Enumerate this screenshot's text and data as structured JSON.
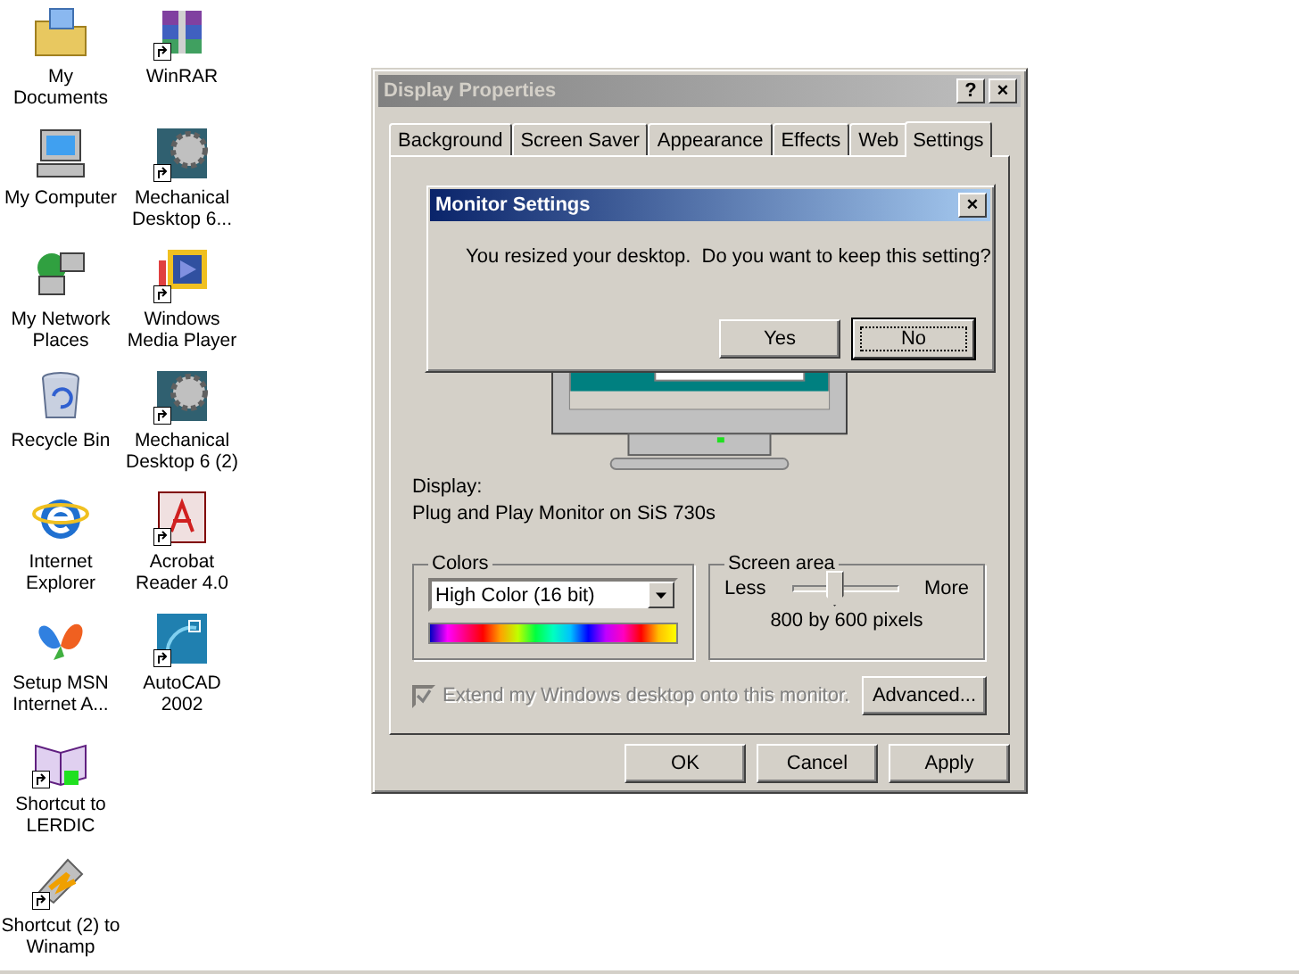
{
  "desktop_icons": [
    {
      "label": "My Documents",
      "shortcut": false
    },
    {
      "label": "My Computer",
      "shortcut": false
    },
    {
      "label": "My Network Places",
      "shortcut": false
    },
    {
      "label": "Recycle Bin",
      "shortcut": false
    },
    {
      "label": "Internet Explorer",
      "shortcut": false
    },
    {
      "label": "Setup MSN Internet A...",
      "shortcut": false
    },
    {
      "label": "Shortcut to LERDIC",
      "shortcut": true
    },
    {
      "label": "Shortcut (2) to Winamp",
      "shortcut": true
    },
    {
      "label": "WinRAR",
      "shortcut": true
    },
    {
      "label": "Mechanical Desktop 6...",
      "shortcut": true
    },
    {
      "label": "Windows Media Player",
      "shortcut": true
    },
    {
      "label": "Mechanical Desktop 6 (2)",
      "shortcut": true
    },
    {
      "label": "Acrobat Reader 4.0",
      "shortcut": true
    },
    {
      "label": "AutoCAD 2002",
      "shortcut": true
    }
  ],
  "window": {
    "title": "Display Properties",
    "title_buttons": [
      "?",
      "×"
    ],
    "active": false,
    "tabs": [
      {
        "label": "Background",
        "selected": false
      },
      {
        "label": "Screen Saver",
        "selected": false
      },
      {
        "label": "Appearance",
        "selected": false
      },
      {
        "label": "Effects",
        "selected": false
      },
      {
        "label": "Web",
        "selected": false
      },
      {
        "label": "Settings",
        "selected": true
      }
    ],
    "display_label": "Display:",
    "display_value": "Plug and Play Monitor on SiS 730s",
    "colors": {
      "legend": "Colors",
      "value": "High Color (16 bit)"
    },
    "screen_area": {
      "legend": "Screen area",
      "less": "Less",
      "more": "More",
      "level": 0.4,
      "reading": "800 by 600 pixels"
    },
    "extend_checkbox": {
      "label": "Extend my Windows desktop onto this monitor.",
      "checked": true,
      "disabled": true
    },
    "advanced_button": "Advanced...",
    "buttons": [
      "OK",
      "Cancel",
      "Apply"
    ]
  },
  "dialog": {
    "title": "Monitor Settings",
    "close": "×",
    "active": true,
    "message": "You resized your desktop.  Do you want to keep this setting?",
    "buttons": [
      {
        "label": "Yes",
        "default": false
      },
      {
        "label": "No",
        "default": true
      }
    ]
  }
}
